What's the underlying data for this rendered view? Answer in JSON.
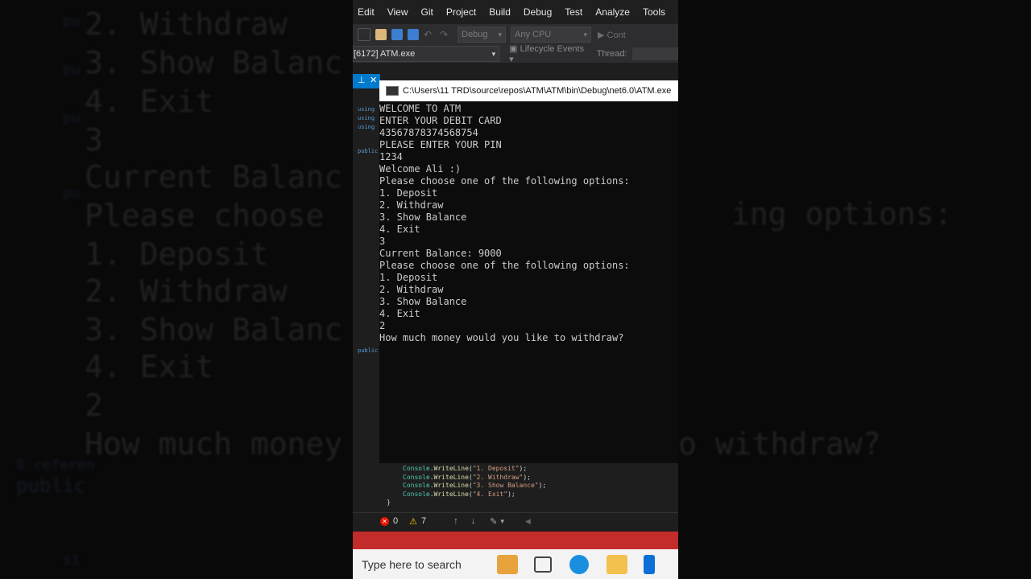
{
  "background_zoom": {
    "left_lines": [
      "2. Withdraw",
      "3. Show Balanc",
      "4. Exit",
      "3",
      "Current Balanc",
      "Please choose",
      "1. Deposit",
      "2. Withdraw",
      "3. Show Balanc",
      "4. Exit",
      "2",
      "How much money"
    ],
    "right_lines": [
      "ing options:",
      "o withdraw?"
    ],
    "left_small": [
      "pu",
      "pu",
      "pu",
      "pu",
      "0 referen",
      "public",
      "st"
    ]
  },
  "menu": {
    "items": [
      "Edit",
      "View",
      "Git",
      "Project",
      "Build",
      "Debug",
      "Test",
      "Analyze",
      "Tools"
    ]
  },
  "toolbar": {
    "config": "Debug",
    "platform": "Any CPU",
    "continue": "Cont"
  },
  "toolbar2": {
    "process": "[6172] ATM.exe",
    "lifecycle": "Lifecycle Events",
    "thread_label": "Thread:"
  },
  "tab": {
    "pin_glyph": "⊥",
    "close_glyph": "✕"
  },
  "console": {
    "title": "C:\\Users\\11 TRD\\source\\repos\\ATM\\ATM\\bin\\Debug\\net6.0\\ATM.exe",
    "lines": [
      "WELCOME TO ATM",
      "ENTER YOUR DEBIT CARD",
      "43567878374568754",
      "PLEASE ENTER YOUR PIN",
      "1234",
      "Welcome Ali :)",
      "Please choose one of the following options:",
      "1. Deposit",
      "2. Withdraw",
      "3. Show Balance",
      "4. Exit",
      "3",
      "Current Balance: 9000",
      "Please choose one of the following options:",
      "1. Deposit",
      "2. Withdraw",
      "3. Show Balance",
      "4. Exit",
      "2",
      "How much money would you like to withdraw?"
    ]
  },
  "code": {
    "lines": [
      {
        "obj": "Console",
        "fn": "WriteLine",
        "str": "\"1. Deposit\""
      },
      {
        "obj": "Console",
        "fn": "WriteLine",
        "str": "\"2. Withdraw\""
      },
      {
        "obj": "Console",
        "fn": "WriteLine",
        "str": "\"3. Show Balance\""
      },
      {
        "obj": "Console",
        "fn": "WriteLine",
        "str": "\"4. Exit\""
      }
    ],
    "closing": "}"
  },
  "status": {
    "errors": "0",
    "warnings": "7"
  },
  "taskbar": {
    "search_placeholder": "Type here to search"
  },
  "colors": {
    "accent": "#007acc",
    "console_bg": "#0c0c0c",
    "error": "#e51400",
    "red_bar": "#c42b2b"
  }
}
